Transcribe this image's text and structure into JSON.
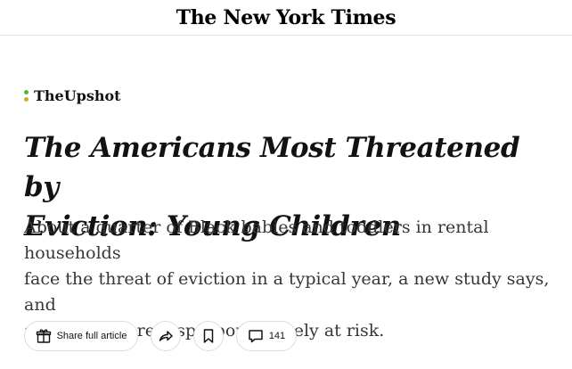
{
  "masthead": {
    "logo_text": "The New York Times"
  },
  "section": {
    "name": "TheUpshot",
    "dot_colors": [
      "#5ab02f",
      "#cfae1d"
    ]
  },
  "article": {
    "headline_line1": "The Americans Most Threatened by",
    "headline_line2": "Eviction: Young Children",
    "summary_line1": "About a quarter of Black babies and toddlers in rental households",
    "summary_line2": "face the threat of eviction in a typical year, a new study says, and",
    "summary_line3": "all children are disproportionately at risk."
  },
  "actions": {
    "share_label": "Share full article",
    "comment_count": "141",
    "share_icon": "gift-icon",
    "forward_icon": "share-arrow-icon",
    "save_icon": "bookmark-icon",
    "comment_icon": "comment-icon"
  }
}
